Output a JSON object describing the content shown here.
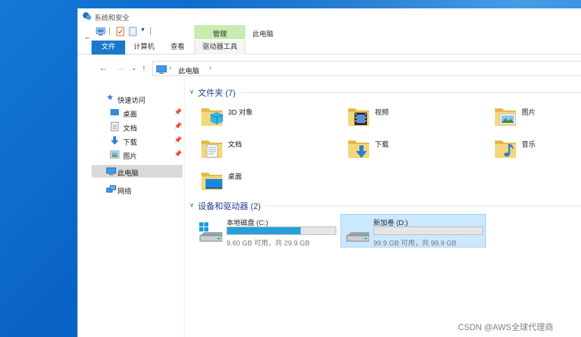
{
  "window": {
    "title": "系统和安全"
  },
  "ribbon": {
    "context_group": "管理",
    "context_title": "此电脑",
    "tabs": [
      {
        "label": "文件"
      },
      {
        "label": "计算机"
      },
      {
        "label": "查看"
      },
      {
        "label": "驱动器工具"
      }
    ]
  },
  "address": {
    "crumbs": [
      "此电脑"
    ]
  },
  "nav_pane": {
    "quick_access": "快速访问",
    "pinned": [
      {
        "label": "桌面",
        "icon": "desktop-icon"
      },
      {
        "label": "文档",
        "icon": "document-icon"
      },
      {
        "label": "下载",
        "icon": "download-icon"
      },
      {
        "label": "图片",
        "icon": "pictures-icon"
      }
    ],
    "this_pc": "此电脑",
    "network": "网络"
  },
  "folders_group": {
    "title": "文件夹 (7)",
    "items": [
      {
        "label": "3D 对象",
        "icon": "3d-objects-folder-icon"
      },
      {
        "label": "视频",
        "icon": "videos-folder-icon"
      },
      {
        "label": "图片",
        "icon": "pictures-folder-icon"
      },
      {
        "label": "文档",
        "icon": "documents-folder-icon"
      },
      {
        "label": "下载",
        "icon": "downloads-folder-icon"
      },
      {
        "label": "音乐",
        "icon": "music-folder-icon"
      },
      {
        "label": "桌面",
        "icon": "desktop-folder-icon"
      }
    ]
  },
  "drives_group": {
    "title": "设备和驱动器 (2)",
    "items": [
      {
        "label": "本地磁盘 (C:)",
        "info": "9.60 GB 可用，共 29.9 GB",
        "used_fraction": 0.68,
        "icon": "windows-drive-icon"
      },
      {
        "label": "新加卷 (D:)",
        "info": "99.9 GB 可用，共 99.9 GB",
        "used_fraction": 0.0,
        "icon": "hard-drive-icon"
      }
    ]
  },
  "watermark": "CSDN @AWS全球代理商",
  "colors": {
    "accent": "#1979ca",
    "drive_fill": "#26a0da",
    "selection": "#cce8ff",
    "context_tab": "#c7ecb0"
  }
}
